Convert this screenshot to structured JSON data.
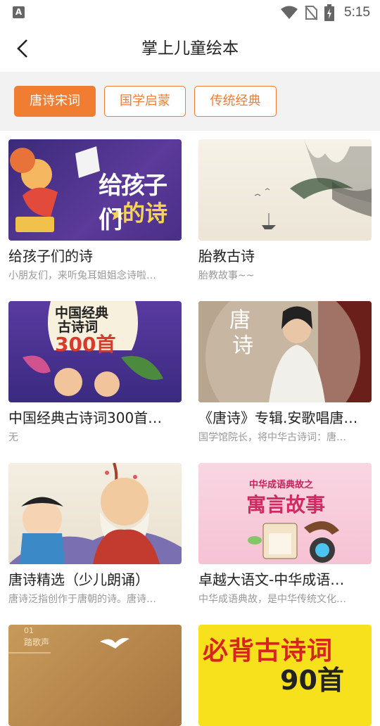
{
  "status_bar": {
    "time": "5:15",
    "notification_icon_letter": "A"
  },
  "header": {
    "title": "掌上儿童绘本"
  },
  "tabs": [
    {
      "label": "唐诗宋词",
      "active": true
    },
    {
      "label": "国学启蒙",
      "active": false
    },
    {
      "label": "传统经典",
      "active": false
    }
  ],
  "items": [
    {
      "title": "给孩子们的诗",
      "subtitle": "小朋友们，来听兔耳姐姐念诗啦…",
      "cover_text": [
        "给孩子们",
        "的诗"
      ]
    },
    {
      "title": "胎教古诗",
      "subtitle": "胎教故事~~",
      "cover_text": []
    },
    {
      "title": "中国经典古诗词300首…",
      "subtitle": "无",
      "cover_text": [
        "中国经典",
        "古诗词",
        "300首"
      ]
    },
    {
      "title": "《唐诗》专辑.安歌唱唐…",
      "subtitle": "国学馆院长，将中华古诗词：唐…",
      "cover_text": [
        "唐",
        "诗"
      ]
    },
    {
      "title": "唐诗精选（少儿朗诵）",
      "subtitle": "唐诗泛指创作于唐朝的诗。唐诗…",
      "cover_text": []
    },
    {
      "title": "卓越大语文-中华成语…",
      "subtitle": "中华成语典故，是中华传统文化…",
      "cover_text": [
        "中华成语典故之",
        "寓言故事"
      ]
    },
    {
      "title": "",
      "subtitle": "",
      "cover_text": [
        "01",
        "踏歌声"
      ]
    },
    {
      "title": "",
      "subtitle": "",
      "cover_text": [
        "必背古诗词",
        "90首"
      ]
    }
  ],
  "colors": {
    "accent": "#f07d32",
    "tab_bar_bg": "#f2f2f2"
  }
}
